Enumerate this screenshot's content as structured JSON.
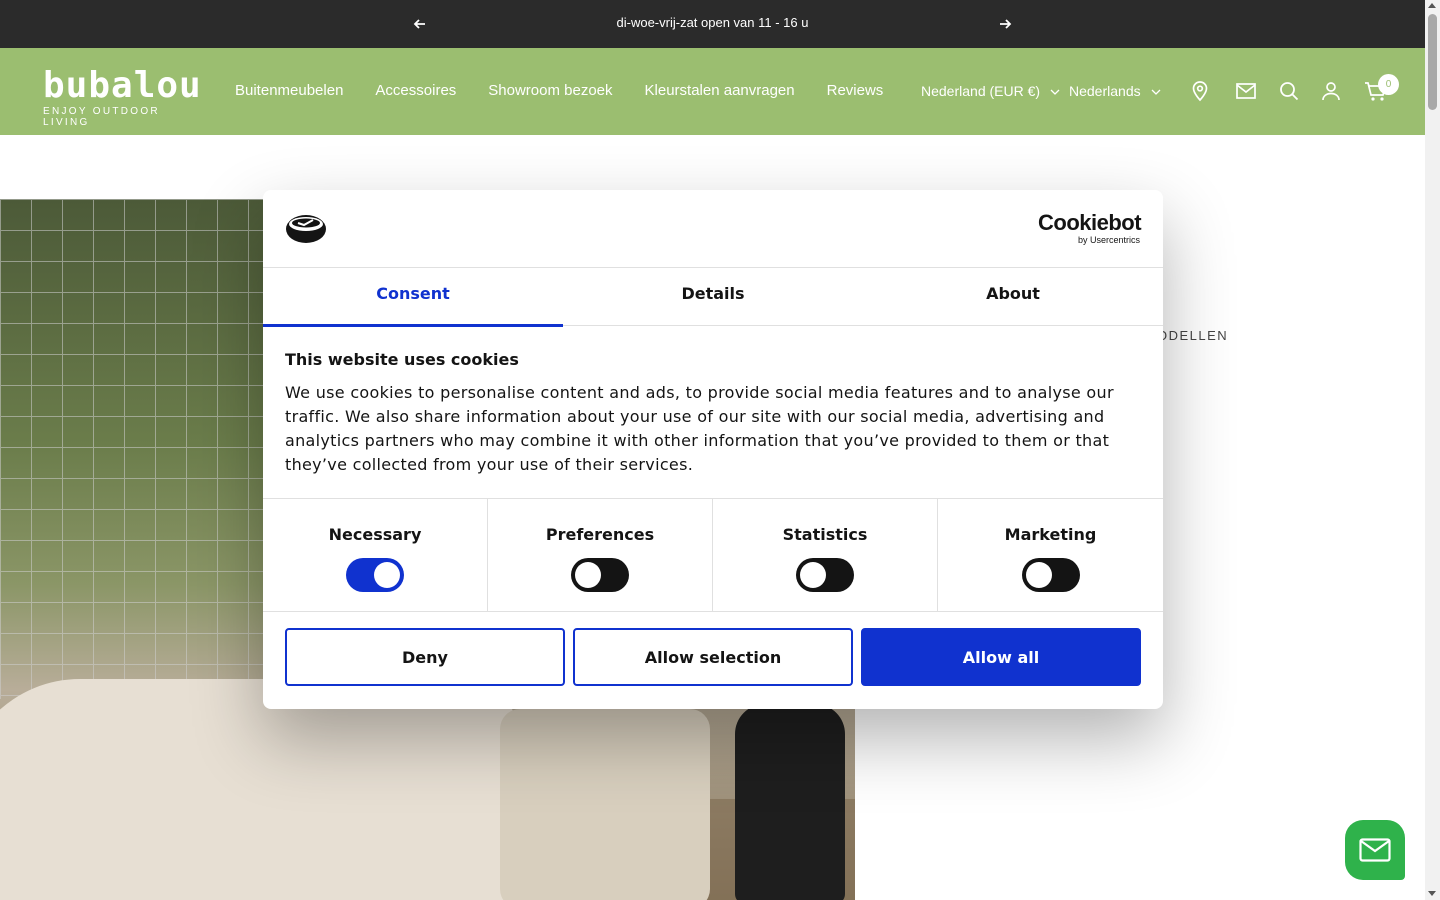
{
  "announcement": {
    "text": "di-woe-vrij-zat open van 11 - 16 u"
  },
  "header": {
    "logo_word": "bubalou",
    "logo_tagline": "ENJOY OUTDOOR LIVING",
    "nav": [
      "Buitenmeubelen",
      "Accessoires",
      "Showroom bezoek",
      "Kleurstalen aanvragen",
      "Reviews"
    ],
    "country": "Nederland (EUR €)",
    "language": "Nederlands",
    "cart_count": "0",
    "icons": [
      "location-pin-icon",
      "mail-icon",
      "search-icon",
      "account-icon",
      "cart-icon"
    ]
  },
  "page": {
    "side_text": "ODELLEN"
  },
  "cookie_dialog": {
    "brand": "Cookiebot",
    "brand_sub": "by Usercentrics",
    "tabs": [
      "Consent",
      "Details",
      "About"
    ],
    "active_tab": "Consent",
    "title": "This website uses cookies",
    "body": "We use cookies to personalise content and ads, to provide social media features and to analyse our traffic. We also share information about your use of our site with our social media, advertising and analytics partners who may combine it with other information that you’ve provided to them or that they’ve collected from your use of their services.",
    "toggles": [
      {
        "label": "Necessary",
        "on": true
      },
      {
        "label": "Preferences",
        "on": false
      },
      {
        "label": "Statistics",
        "on": false
      },
      {
        "label": "Marketing",
        "on": false
      }
    ],
    "buttons": {
      "deny": "Deny",
      "allow_selection": "Allow selection",
      "allow_all": "Allow all"
    }
  },
  "colors": {
    "header_green": "#9bbe70",
    "accent_blue": "#1032cf",
    "announce_bg": "#2b2b2b",
    "chat_green": "#2fb24b"
  }
}
